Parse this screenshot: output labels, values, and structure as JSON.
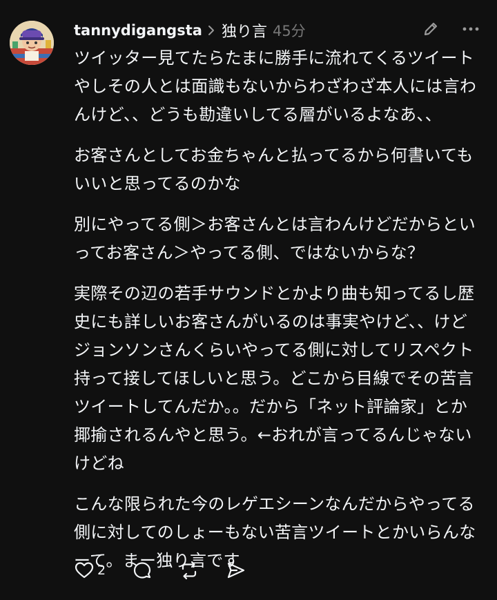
{
  "post": {
    "username": "tannydigangsta",
    "topic": "独り言",
    "time": "45分",
    "paragraphs": [
      "ツイッター見てたらたまに勝手に流れてくるツイートやしその人とは面識もないからわざわざ本人には言わんけど、、どうも勘違いしてる層がいるよなあ、、",
      "お客さんとしてお金ちゃんと払ってるから何書いてもいいと思ってるのかな",
      "別にやってる側＞お客さんとは言わんけどだからといってお客さん＞やってる側、ではないからな？",
      "実際その辺の若手サウンドとかより曲も知ってるし歴史にも詳しいお客さんがいるのは事実やけど、、けどジョンソンさんくらいやってる側に対してリスペクト持って接してほしいと思う。どこから目線でその苦言ツイートしてんだか。。だから「ネット評論家」とか揶揄されるんやと思う。←おれが言ってるんじゃないけどね",
      "こんな限られた今のレゲエシーンなんだからやってる側に対してのしょーもない苦言ツイートとかいらんなーて。まー独り言です"
    ],
    "like_count": "2"
  },
  "icons": {
    "edit": "pencil-icon",
    "more": "more-icon",
    "like": "heart-icon",
    "reply": "comment-icon",
    "repost": "repost-icon",
    "share": "send-icon"
  },
  "colors": {
    "background": "#101010",
    "text": "#f3f5f7",
    "muted": "#777777"
  }
}
